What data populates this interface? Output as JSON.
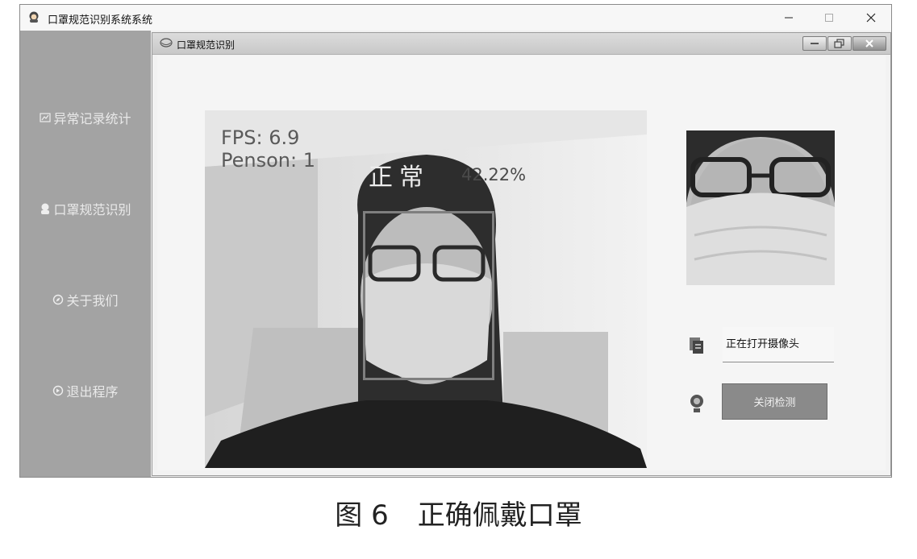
{
  "window": {
    "title": "口罩规范识别系统系统"
  },
  "sidebar": {
    "items": [
      {
        "label": "异常记录统计",
        "icon": "chart-icon"
      },
      {
        "label": "口罩规范识别",
        "icon": "person-icon"
      },
      {
        "label": "关于我们",
        "icon": "compass-icon"
      },
      {
        "label": "退出程序",
        "icon": "exit-icon"
      }
    ]
  },
  "inner_window": {
    "title": "口罩规范识别"
  },
  "camera": {
    "fps_text": "FPS: 6.9",
    "person_text": "Penson: 1",
    "status_text": "正常",
    "confidence_text": "42.22%"
  },
  "controls": {
    "status_value": "正在打开摄像头",
    "close_button_label": "关闭检测"
  },
  "caption": {
    "figure_num": "图 6",
    "text": "正确佩戴口罩"
  }
}
